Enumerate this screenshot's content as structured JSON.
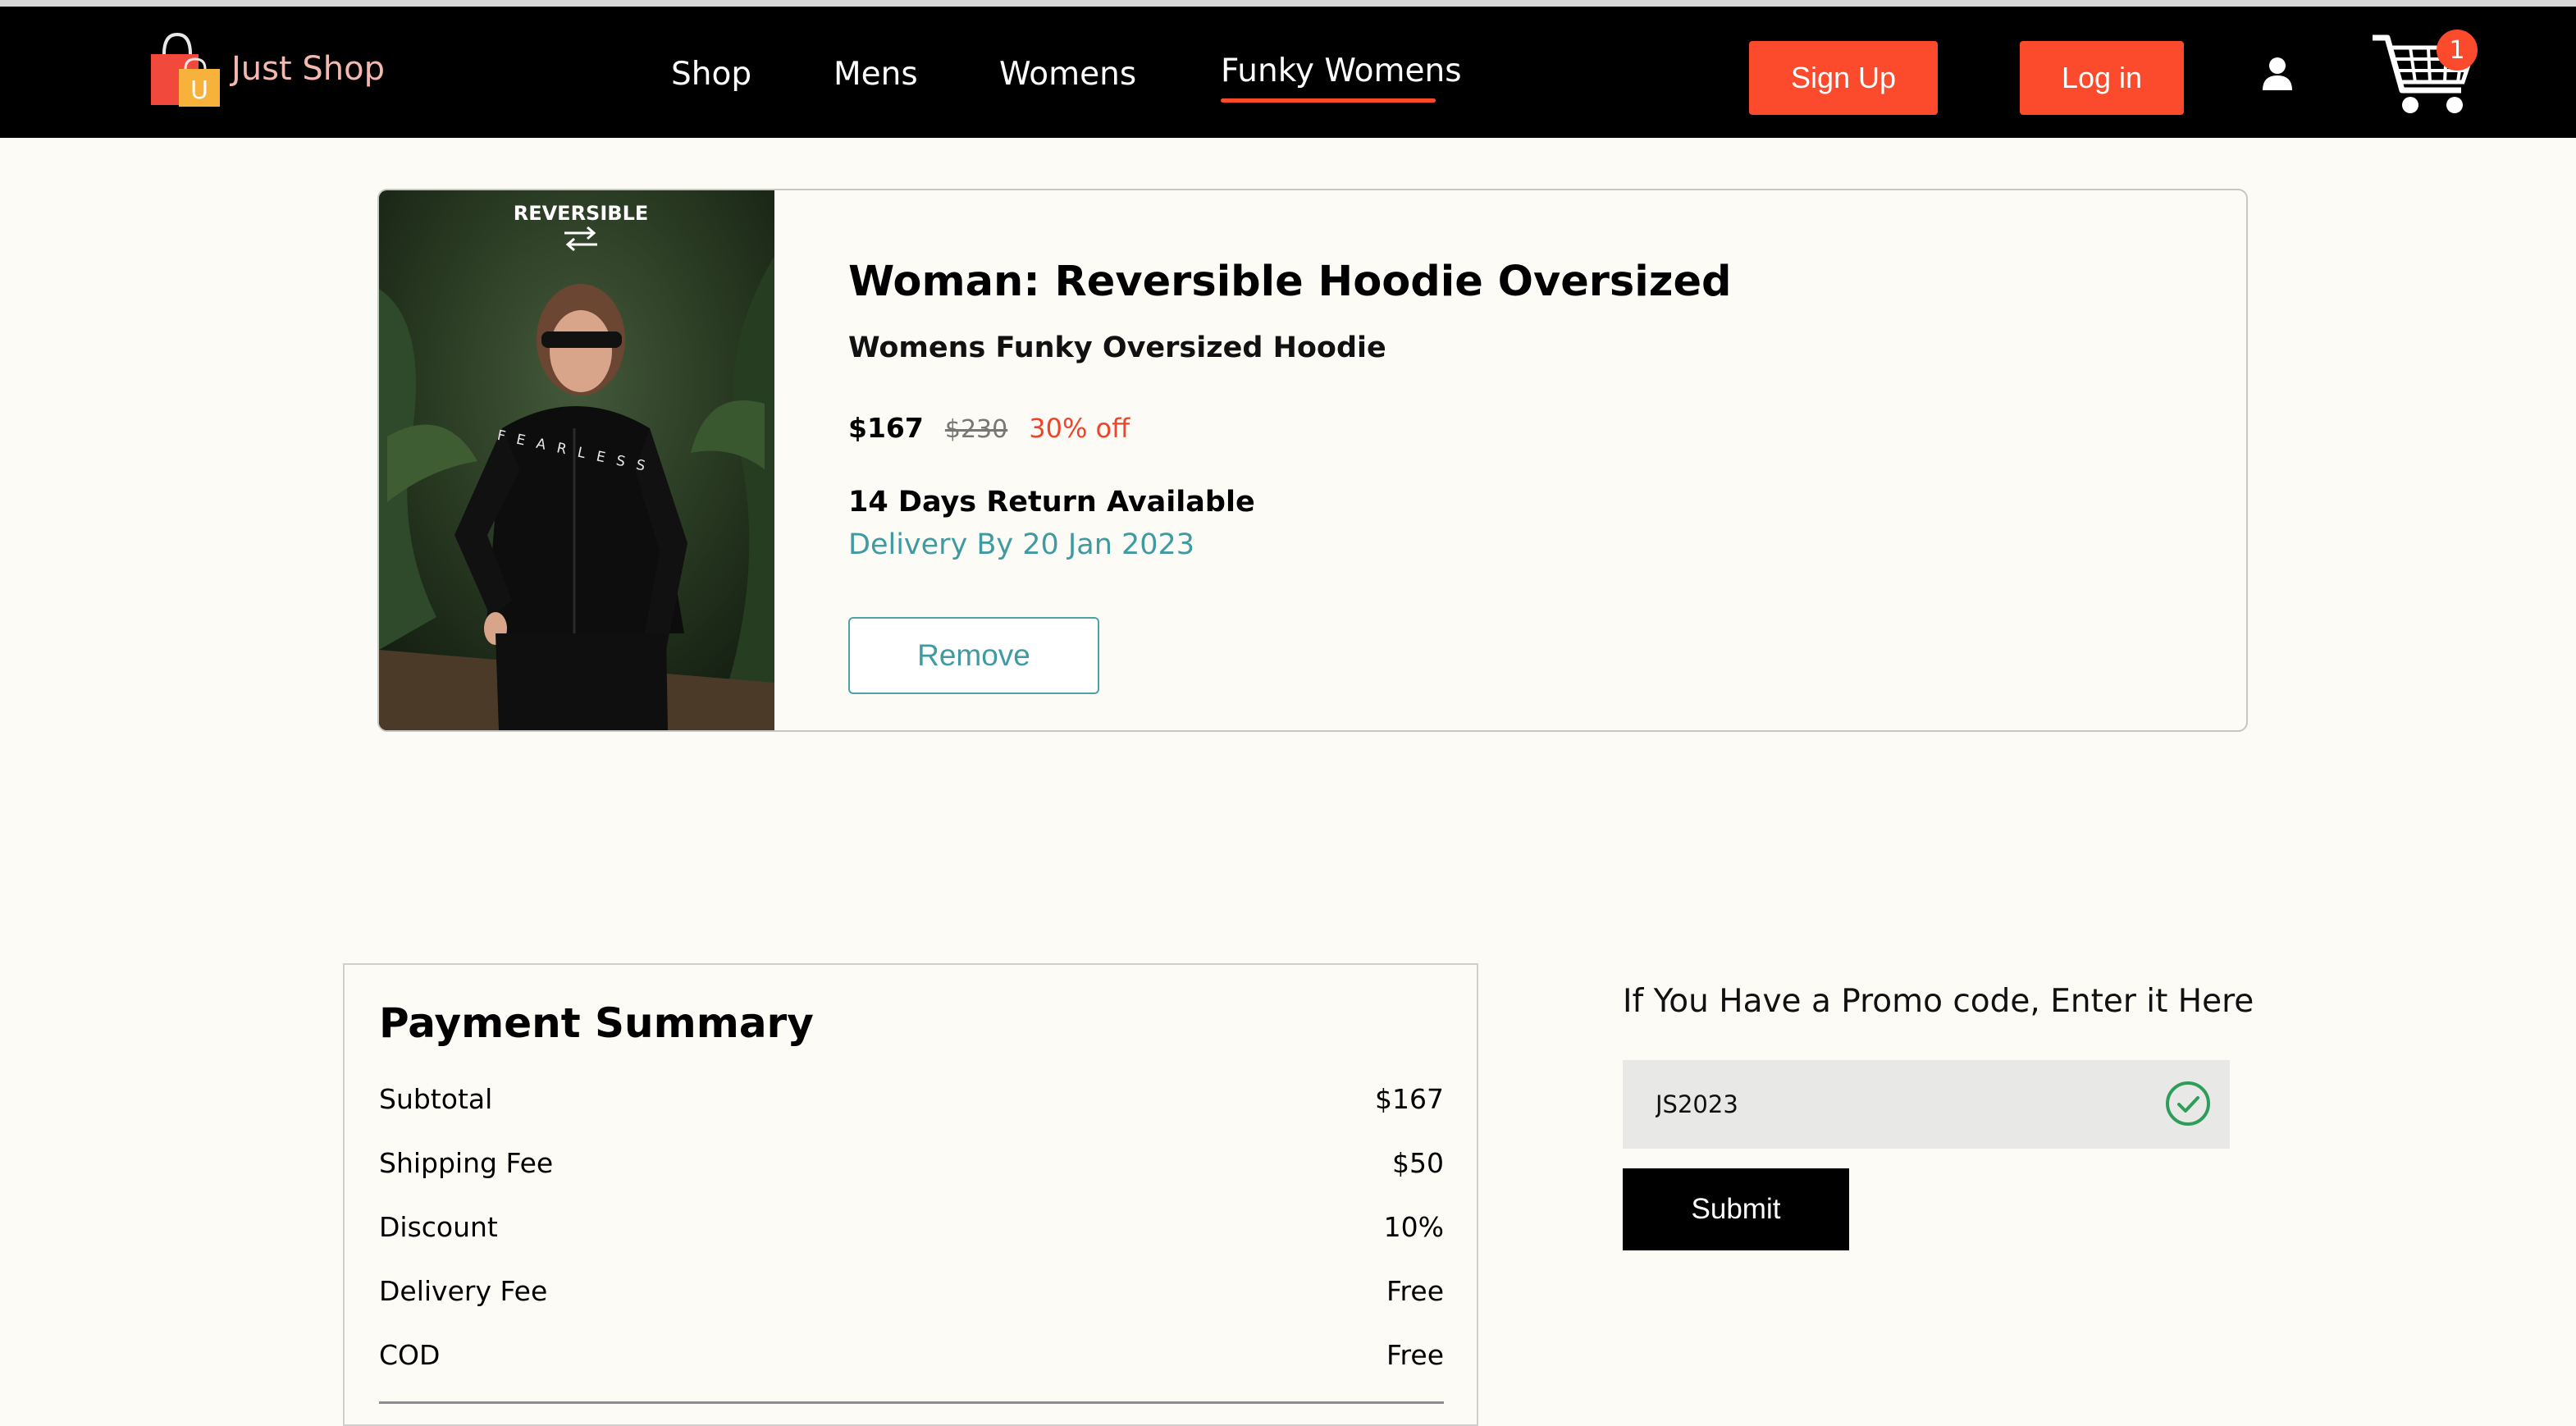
{
  "brand": {
    "name": "Just Shop",
    "logo_letter": "U",
    "colors": {
      "primary_orange": "#fb4b2c",
      "teal": "#3f9ba1",
      "navbar": "#000000"
    }
  },
  "nav": {
    "links": [
      "Shop",
      "Mens",
      "Womens",
      "Funky Womens"
    ],
    "active": "Funky Womens",
    "signup_label": "Sign Up",
    "login_label": "Log in",
    "user_icon": "user-icon",
    "cart_icon": "cart-icon",
    "cart_count": "1"
  },
  "product": {
    "image_label": "REVERSIBLE",
    "shirt_text": "FEARLESS",
    "title": "Woman: Reversible Hoodie Oversized",
    "subtitle": "Womens Funky Oversized Hoodie",
    "price": "$167",
    "original_price": "$230",
    "discount": "30% off",
    "return_policy": "14 Days Return Available",
    "delivery": "Delivery By 20 Jan 2023",
    "remove_label": "Remove"
  },
  "summary": {
    "title": "Payment Summary",
    "rows": [
      {
        "label": "Subtotal",
        "value": "$167"
      },
      {
        "label": "Shipping Fee",
        "value": "$50"
      },
      {
        "label": "Discount",
        "value": "10%"
      },
      {
        "label": "Delivery Fee",
        "value": "Free"
      },
      {
        "label": "COD",
        "value": "Free"
      }
    ]
  },
  "promo": {
    "label": "If You Have a Promo code, Enter it Here",
    "value": "JS2023",
    "status_icon": "check-circle-icon",
    "submit_label": "Submit"
  }
}
